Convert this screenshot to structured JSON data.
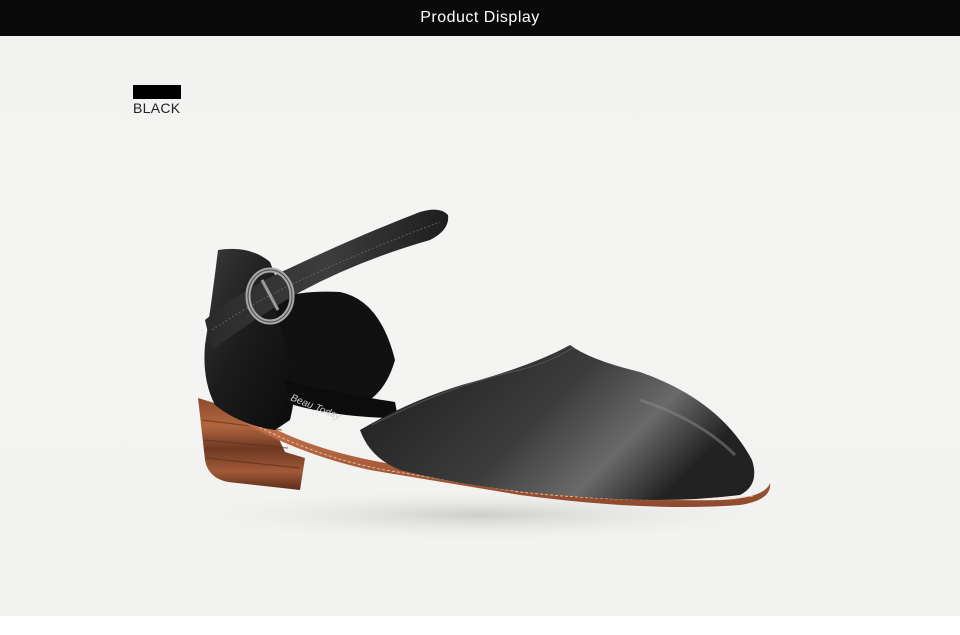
{
  "header": {
    "title": "Product Display"
  },
  "product": {
    "color_name": "BLACK",
    "swatch_color": "#000000",
    "insole_brand": "Beau Today"
  },
  "theme": {
    "header_bg": "#0a0a0a",
    "photo_bg": "#f3f3f1",
    "leather": "#1a1a1a",
    "sole_wood": "#a5573a"
  }
}
